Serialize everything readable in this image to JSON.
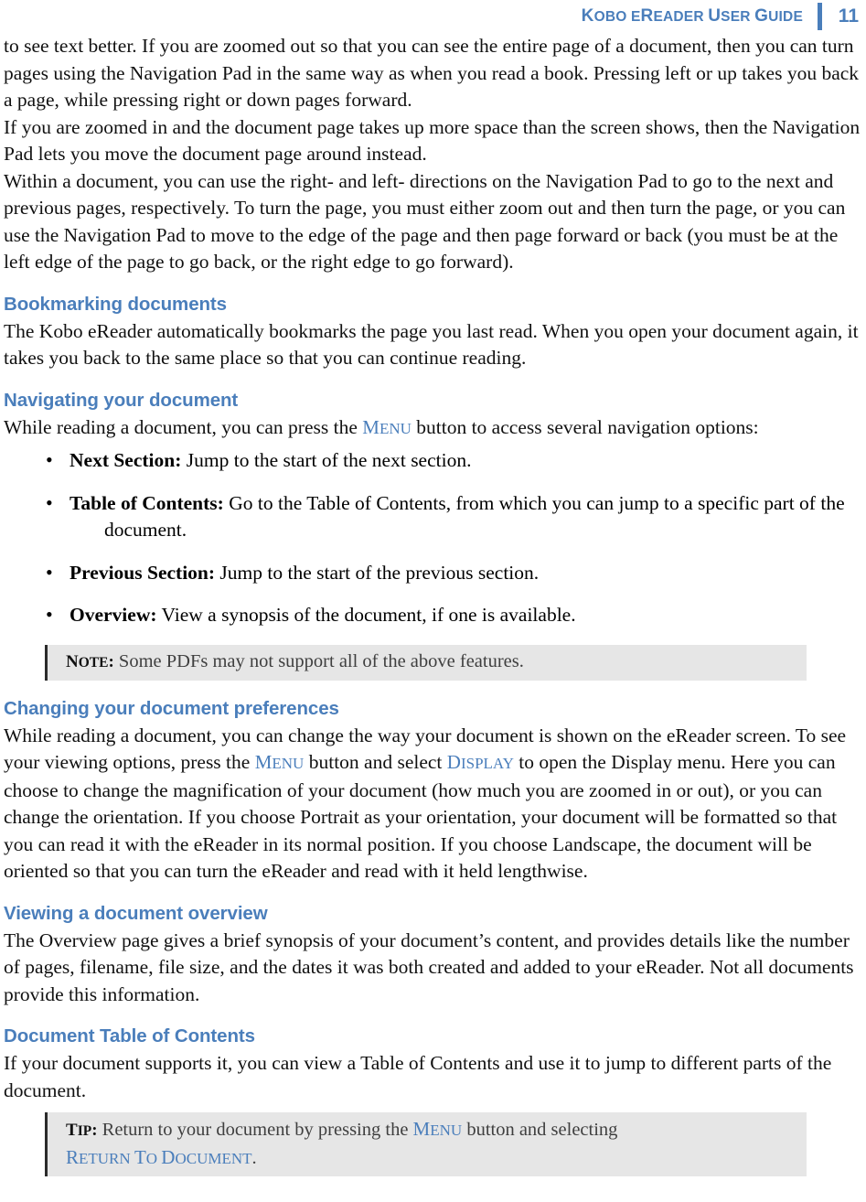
{
  "header": {
    "title_words": [
      {
        "first": "K",
        "rest": "OBO"
      },
      {
        "first": "E",
        "rest": "READER"
      },
      {
        "first": "U",
        "rest": "SER"
      },
      {
        "first": "G",
        "rest": "UIDE"
      }
    ],
    "title_plain": "KOBO EREADER USER GUIDE",
    "page_number": "11",
    "accent_color": "#4a7ebb"
  },
  "content": {
    "paragraph_1": "to see text better. If you are zoomed out so that you can see the entire page of a document, then you can turn pages using the Navigation Pad in the same way as when you read a book. Pressing left or up takes you back a page, while pressing right or down pages forward.",
    "paragraph_2": "If you are zoomed in and the document page takes up more space than the screen shows, then the Navigation Pad lets you move the document page around instead.",
    "paragraph_3": " Within a document, you can use the right- and left- directions on the Navigation Pad to go to the next and previous pages, respectively. To turn the page, you must either zoom out and then turn the page, or you can use the Navigation Pad to move to the edge of the page and then page forward or back (you must be at the left edge of the page to go back, or the right edge to go forward).",
    "heading_bookmarking": "Bookmarking documents",
    "paragraph_bookmarking": "The Kobo eReader automatically bookmarks the page you last read. When you open your document again, it takes you back to the same place so that you can continue reading.",
    "heading_navigating": "Navigating your document",
    "navigating_intro_before": "While reading a document, you can press the ",
    "navigating_menu_c1": "M",
    "navigating_menu_rest": "ENU",
    "navigating_intro_after": " button to access several navigation options:",
    "bullets": [
      {
        "lead": "Next Section:",
        "text": " Jump to the start of the next section."
      },
      {
        "lead": "Table of Contents:",
        "text": " Go to the Table of Contents, from which you can jump to a specific part of the document."
      },
      {
        "lead": "Previous Section:",
        "text": " Jump to the start of the previous section."
      },
      {
        "lead": "Overview:",
        "text": " View a synopsis of the document, if one is available."
      }
    ],
    "note_tag_c1": "N",
    "note_tag_rest": "OTE",
    "note_tag_colon": ":",
    "note_text": " Some PDFs may not support all of the above features.",
    "heading_preferences": "Changing your document preferences",
    "preferences_part_1": "While reading a document, you can change the way your document is shown on the eReader screen. To see your viewing options, press the ",
    "preferences_menu_c1": "M",
    "preferences_menu_rest": "ENU",
    "preferences_part_2": " button and select ",
    "preferences_display_c1": "D",
    "preferences_display_rest": "ISPLAY",
    "preferences_part_3": " to open the Display menu. Here you can choose to change the magnification of your document (how much you are zoomed in or out), or you can change the orientation. If you choose Portrait as your orientation, your document will be formatted so that you can read it with the eReader in its normal position. If you choose Landscape, the document will be oriented so that you can turn the eReader and read with it held lengthwise.",
    "heading_overview": "Viewing a document overview",
    "paragraph_overview": "The Overview page gives a brief synopsis of your document’s content, and provides details like the number of pages, filename, file size, and the dates it was both created and added to your eReader. Not all documents provide this information.",
    "heading_toc": "Document Table of Contents",
    "paragraph_toc": "If your document supports it, you can view a Table of Contents and use it to jump to different parts of the document.",
    "tip_tag_c1": "T",
    "tip_tag_rest": "IP",
    "tip_tag_colon": ":",
    "tip_part_1": " Return to your document by pressing the ",
    "tip_menu_c1": "M",
    "tip_menu_rest": "ENU",
    "tip_part_2": " button and selecting ",
    "tip_return_c1": "R",
    "tip_return_rest": "ETURN",
    "tip_part_3": " ",
    "tip_to_c1": "T",
    "tip_to_rest": "O",
    "tip_part_4": " ",
    "tip_doc_c1": "D",
    "tip_doc_rest": "OCUMENT",
    "tip_part_5": "."
  }
}
